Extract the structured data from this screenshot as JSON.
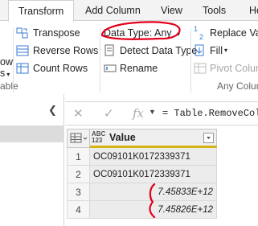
{
  "tabs": [
    "Transform",
    "Add Column",
    "View",
    "Tools",
    "He"
  ],
  "ribbon": {
    "transpose": "Transpose",
    "reverse_rows": "Reverse Rows",
    "count_rows": "Count Rows",
    "data_type": "Data Type: Any",
    "detect_data_type": "Detect Data Type",
    "rename": "Rename",
    "replace_values": "Replace Valu",
    "fill": "Fill",
    "pivot_column": "Pivot Colum",
    "group_left_partial": "able",
    "row_partial": "ow",
    "s_partial": "s",
    "any_column_label": "Any Colum"
  },
  "formula": {
    "text": "= Table.RemoveColu"
  },
  "grid": {
    "column_header": "Value",
    "type_top": "ABC",
    "type_bottom": "123",
    "rows": [
      {
        "n": "1",
        "value": "OC09101K0172339371",
        "numeric": false
      },
      {
        "n": "2",
        "value": "OC09101K0172339371",
        "numeric": false
      },
      {
        "n": "3",
        "value": "7.45833E+12",
        "numeric": true
      },
      {
        "n": "4",
        "value": "7.45826E+12",
        "numeric": true
      }
    ]
  },
  "colors": {
    "annotation": "#e3001b",
    "header_accent": "#d7b415",
    "tab_bar": "#f3f3f3"
  }
}
